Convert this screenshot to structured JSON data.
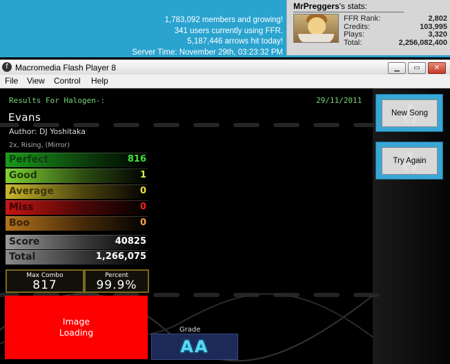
{
  "banner": {
    "members": "1,783,092 members and growing!",
    "users": "341 users currently using FFR.",
    "arrows": "5,187,446 arrows hit today!",
    "server_time": "Server Time: November 29th, 03:23:32 PM"
  },
  "user_stats": {
    "username": "MrPreggers",
    "title_suffix": "'s stats:",
    "rows": [
      {
        "label": "FFR Rank:",
        "value": "2,802"
      },
      {
        "label": "Credits:",
        "value": "103,995"
      },
      {
        "label": "Plays:",
        "value": "3,320"
      },
      {
        "label": "Total:",
        "value": "2,256,082,400"
      }
    ]
  },
  "window": {
    "title": "Macromedia Flash Player 8",
    "menu": [
      "File",
      "View",
      "Control",
      "Help"
    ]
  },
  "results": {
    "title": "Results For Halogen-:",
    "date": "29/11/2011",
    "song": "Evans",
    "author": "Author: DJ Yoshitaka",
    "mods": "2x, Rising, (Mirror)",
    "judgements": [
      {
        "label": "Perfect",
        "value": "816"
      },
      {
        "label": "Good",
        "value": "1"
      },
      {
        "label": "Average",
        "value": "0"
      },
      {
        "label": "Miss",
        "value": "0"
      },
      {
        "label": "Boo",
        "value": "0"
      }
    ],
    "score_label": "Score",
    "score": "40825",
    "total_label": "Total",
    "total": "1,266,075",
    "max_combo_label": "Max Combo",
    "max_combo": "817",
    "percent_label": "Percent",
    "percent": "99.9%",
    "image_loading": "Image Loading",
    "grade_label": "Grade",
    "grade": "AA"
  },
  "buttons": {
    "new_song": "New Song",
    "try_again": "Try Again"
  },
  "colors": {
    "banner_bg": "#2aa3cf",
    "perfect": "#3fe33f",
    "good": "#c9ff3c",
    "average": "#f0e23a",
    "miss": "#ff2020",
    "boo": "#ffa53a",
    "image_placeholder": "#ff0000",
    "button_frame": "#39a7d6"
  }
}
